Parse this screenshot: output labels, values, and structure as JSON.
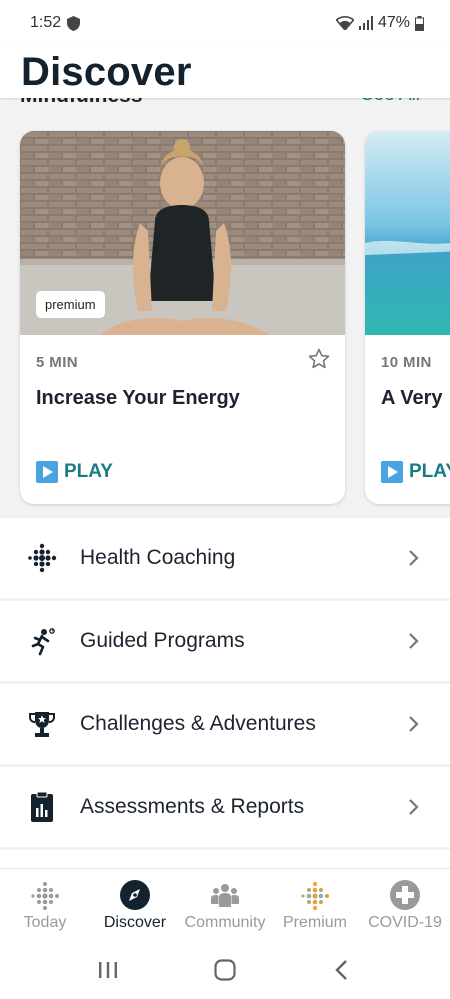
{
  "status": {
    "time": "1:52",
    "battery": "47%"
  },
  "header": {
    "title": "Discover"
  },
  "section": {
    "title": "Mindfulness",
    "see_all": "See All"
  },
  "cards": [
    {
      "badge": "premium",
      "duration": "5 MIN",
      "title": "Increase Your Energy",
      "play": "PLAY"
    },
    {
      "duration": "10 MIN",
      "title": "A Very",
      "play": "PLAY"
    }
  ],
  "list": [
    {
      "label": "Health Coaching",
      "icon": "dots-grid-icon"
    },
    {
      "label": "Guided Programs",
      "icon": "runner-icon"
    },
    {
      "label": "Challenges & Adventures",
      "icon": "trophy-icon"
    },
    {
      "label": "Assessments & Reports",
      "icon": "clipboard-chart-icon"
    }
  ],
  "nav": [
    {
      "label": "Today",
      "icon": "fitbit-dots-icon"
    },
    {
      "label": "Discover",
      "icon": "compass-icon",
      "active": true
    },
    {
      "label": "Community",
      "icon": "people-icon"
    },
    {
      "label": "Premium",
      "icon": "premium-dots-icon"
    },
    {
      "label": "COVID-19",
      "icon": "plus-circle-icon"
    }
  ],
  "colors": {
    "accent": "#197c82",
    "title": "#13222e",
    "premium_gold": "#e0a23a"
  }
}
